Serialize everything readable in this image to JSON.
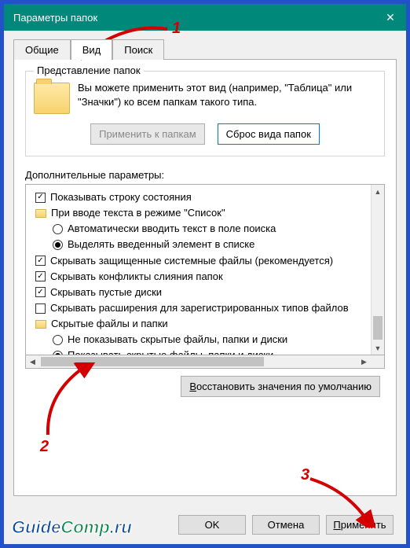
{
  "titlebar": {
    "title": "Параметры папок",
    "close_tooltip": "Закрыть"
  },
  "tabs": {
    "t0": "Общие",
    "t1": "Вид",
    "t2": "Поиск"
  },
  "groupbox": {
    "legend": "Представление папок",
    "description": "Вы можете применить этот вид (например, \"Таблица\" или \"Значки\") ко всем папкам такого типа.",
    "apply_btn": "Применить к папкам",
    "reset_btn": "Сброс вида папок"
  },
  "advanced_label": "Дополнительные параметры:",
  "tree": {
    "item0": "Показывать строку состояния",
    "item1": "При вводе текста в режиме \"Список\"",
    "item1a": "Автоматически вводить текст в поле поиска",
    "item1b": "Выделять введенный элемент в списке",
    "item2": "Скрывать защищенные системные файлы (рекомендуется)",
    "item3": "Скрывать конфликты слияния папок",
    "item4": "Скрывать пустые диски",
    "item5": "Скрывать расширения для зарегистрированных типов файлов",
    "item6": "Скрытые файлы и папки",
    "item6a": "Не показывать скрытые файлы, папки и диски",
    "item6b": "Показывать скрытые файлы, папки и диски"
  },
  "restore_btn": "Восстановить значения по умолчанию",
  "footer": {
    "ok": "OK",
    "cancel": "Отмена",
    "apply": "Применить"
  },
  "annotations": {
    "n1": "1",
    "n2": "2",
    "n3": "3"
  },
  "logo": {
    "part1": "Guide",
    "part2": "Comp",
    "suffix": ".ru"
  }
}
